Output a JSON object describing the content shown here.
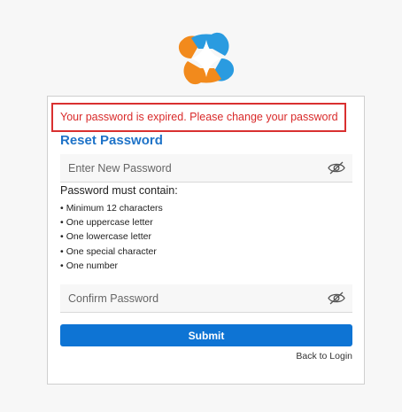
{
  "colors": {
    "accent": "#0e74d4",
    "title": "#1e73c8",
    "error": "#d92a2a",
    "logo_orange": "#f28a1c",
    "logo_blue": "#2a9be0"
  },
  "alert": {
    "message": "Your password is expired. Please change your password"
  },
  "form": {
    "title": "Reset Password",
    "new_password": {
      "placeholder": "Enter New Password",
      "value": "",
      "toggle_icon": "eye-off-icon"
    },
    "requirements": {
      "title": "Password must contain:",
      "items": [
        "Minimum 12 characters",
        "One uppercase letter",
        "One lowercase letter",
        "One special character",
        "One number"
      ]
    },
    "confirm_password": {
      "placeholder": "Confirm Password",
      "value": "",
      "toggle_icon": "eye-off-icon"
    },
    "submit_label": "Submit",
    "back_link": "Back to Login"
  }
}
